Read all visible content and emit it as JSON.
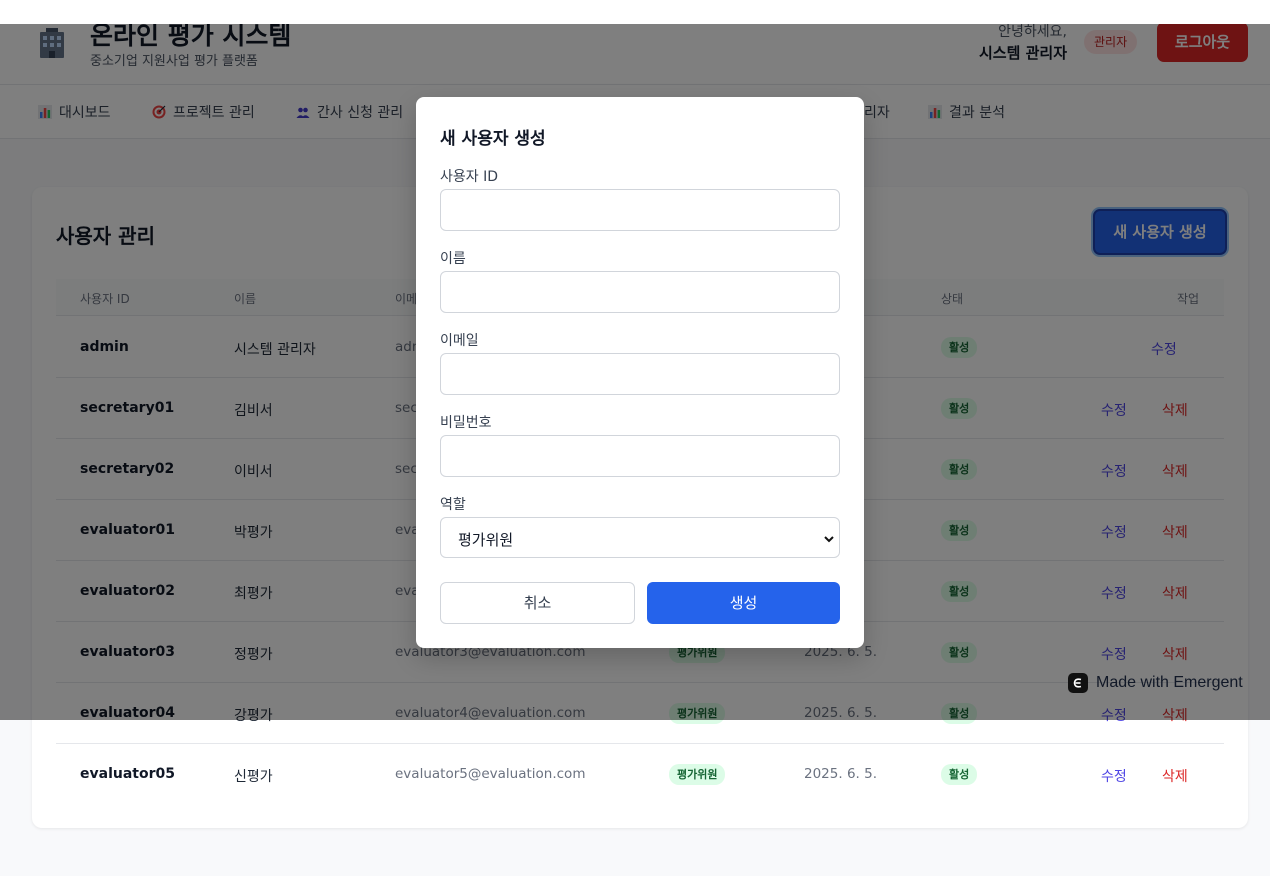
{
  "header": {
    "app_title": "온라인 평가 시스템",
    "app_subtitle": "중소기업 지원사업 평가 플랫폼",
    "greeting": "안녕하세요,",
    "user_name": "시스템 관리자",
    "role_badge": "관리자",
    "logout_label": "로그아웃",
    "logo_icon": "building-icon"
  },
  "nav": {
    "items": [
      {
        "label": "대시보드",
        "icon": "bar-chart-icon"
      },
      {
        "label": "프로젝트 관리",
        "icon": "target-icon"
      },
      {
        "label": "간사 신청 관리",
        "icon": "users-icon"
      },
      {
        "label": "리자",
        "icon": ""
      },
      {
        "label": "결과 분석",
        "icon": "bar-chart-icon"
      }
    ]
  },
  "users_card": {
    "title": "사용자 관리",
    "new_user_button": "새 사용자 생성",
    "columns": [
      "사용자 ID",
      "이름",
      "이메",
      "상태",
      "작업"
    ],
    "edit_label": "수정",
    "delete_label": "삭제",
    "rows": [
      {
        "id": "admin",
        "name": "시스템 관리자",
        "email": "adm",
        "role": "",
        "date": ".",
        "status": "활성",
        "deletable": false
      },
      {
        "id": "secretary01",
        "name": "김비서",
        "email": "sec",
        "role": "",
        "date": ".",
        "status": "활성",
        "deletable": true
      },
      {
        "id": "secretary02",
        "name": "이비서",
        "email": "sec",
        "role": "",
        "date": ".",
        "status": "활성",
        "deletable": true
      },
      {
        "id": "evaluator01",
        "name": "박평가",
        "email": "eva",
        "role": "",
        "date": ".",
        "status": "활성",
        "deletable": true
      },
      {
        "id": "evaluator02",
        "name": "최평가",
        "email": "eva",
        "role": "",
        "date": ".",
        "status": "활성",
        "deletable": true
      },
      {
        "id": "evaluator03",
        "name": "정평가",
        "email": "evaluator3@evaluation.com",
        "role": "평가위원",
        "date": "2025. 6. 5.",
        "status": "활성",
        "deletable": true
      },
      {
        "id": "evaluator04",
        "name": "강평가",
        "email": "evaluator4@evaluation.com",
        "role": "평가위원",
        "date": "2025. 6. 5.",
        "status": "활성",
        "deletable": true
      },
      {
        "id": "evaluator05",
        "name": "신평가",
        "email": "evaluator5@evaluation.com",
        "role": "평가위원",
        "date": "2025. 6. 5.",
        "status": "활성",
        "deletable": true
      }
    ]
  },
  "modal": {
    "title": "새 사용자 생성",
    "fields": [
      {
        "label": "사용자 ID",
        "value": "",
        "placeholder": ""
      },
      {
        "label": "이름",
        "value": "",
        "placeholder": ""
      },
      {
        "label": "이메일",
        "value": "",
        "placeholder": ""
      },
      {
        "label": "비밀번호",
        "value": "",
        "placeholder": ""
      }
    ],
    "role_label": "역할",
    "role_selected": "평가위원",
    "cancel_label": "취소",
    "create_label": "생성"
  },
  "badge": {
    "text": "Made with Emergent"
  },
  "colors": {
    "primary": "#2563eb",
    "danger": "#dc2626",
    "success_bg": "#dcfce7",
    "success_text": "#166534",
    "edit_link": "#4f46e5"
  }
}
